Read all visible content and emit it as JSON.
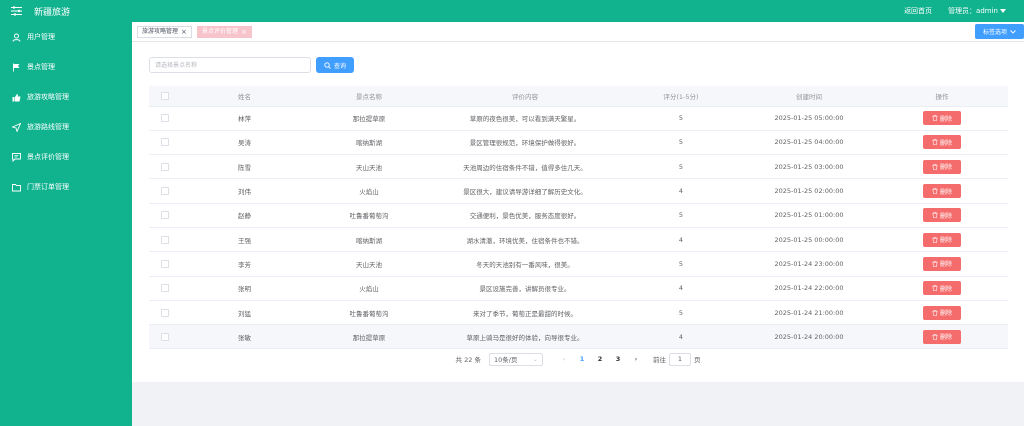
{
  "app": {
    "title": "新疆旅游"
  },
  "topbar": {
    "home_link": "返回首页",
    "admin_label": "管理员：admin"
  },
  "sidebar": {
    "items": [
      {
        "label": "用户管理",
        "icon": "user-icon"
      },
      {
        "label": "景点管理",
        "icon": "flag-icon"
      },
      {
        "label": "旅游攻略管理",
        "icon": "thumb-icon"
      },
      {
        "label": "旅游路线管理",
        "icon": "send-icon"
      },
      {
        "label": "景点评价管理",
        "icon": "comment-icon"
      },
      {
        "label": "门票订单管理",
        "icon": "folder-icon"
      }
    ]
  },
  "tabs": [
    {
      "label": "旅游攻略管理",
      "active": false
    },
    {
      "label": "景点评价管理",
      "active": true
    }
  ],
  "tag_options": "标签选项",
  "search": {
    "placeholder": "请选择景点名称",
    "button": "查询"
  },
  "table": {
    "headers": [
      "姓名",
      "景点名称",
      "评价内容",
      "评分(1-5分)",
      "创建时间",
      "操作"
    ],
    "delete_label": "删除",
    "rows": [
      {
        "name": "林萍",
        "spot": "那拉提草原",
        "content": "草原的夜色很美，可以看到满天繁星。",
        "score": "5",
        "created": "2025-01-25 05:00:00"
      },
      {
        "name": "吴涛",
        "spot": "喀纳斯湖",
        "content": "景区管理很规范，环境保护做得很好。",
        "score": "5",
        "created": "2025-01-25 04:00:00"
      },
      {
        "name": "陈雪",
        "spot": "天山天池",
        "content": "天池周边的住宿条件不错，值得多住几天。",
        "score": "5",
        "created": "2025-01-25 03:00:00"
      },
      {
        "name": "刘伟",
        "spot": "火焰山",
        "content": "景区很大，建议请导游详细了解历史文化。",
        "score": "4",
        "created": "2025-01-25 02:00:00"
      },
      {
        "name": "赵静",
        "spot": "吐鲁番葡萄沟",
        "content": "交通便利，景色优美，服务态度很好。",
        "score": "5",
        "created": "2025-01-25 01:00:00"
      },
      {
        "name": "王强",
        "spot": "喀纳斯湖",
        "content": "湖水清澈，环境优美，住宿条件也不错。",
        "score": "4",
        "created": "2025-01-25 00:00:00"
      },
      {
        "name": "李芳",
        "spot": "天山天池",
        "content": "冬天的天池别有一番风味，很美。",
        "score": "5",
        "created": "2025-01-24 23:00:00"
      },
      {
        "name": "张明",
        "spot": "火焰山",
        "content": "景区设施完善，讲解员很专业。",
        "score": "4",
        "created": "2025-01-24 22:00:00"
      },
      {
        "name": "刘猛",
        "spot": "吐鲁番葡萄沟",
        "content": "来对了季节，葡萄正是最甜的时候。",
        "score": "5",
        "created": "2025-01-24 21:00:00"
      },
      {
        "name": "张敏",
        "spot": "那拉提草原",
        "content": "草原上骑马是很好的体验，向导很专业。",
        "score": "4",
        "created": "2025-01-24 20:00:00"
      }
    ]
  },
  "pagination": {
    "total": "共 22 条",
    "page_size": "10条/页",
    "pages": [
      "1",
      "2",
      "3"
    ],
    "current": "1",
    "goto_prefix": "前往",
    "goto_value": "1",
    "goto_suffix": "页"
  },
  "colors": {
    "primary": "#11b38f",
    "accent": "#409eff",
    "danger": "#f56c6c",
    "tab_active": "#f7c4cc"
  }
}
